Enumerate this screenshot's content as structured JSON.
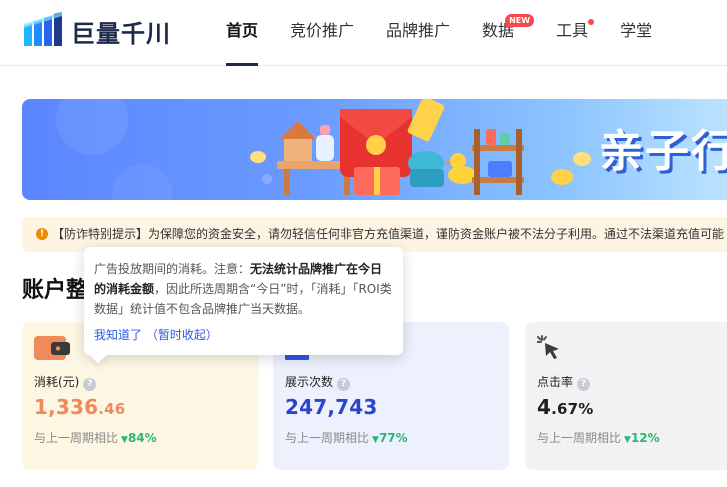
{
  "header": {
    "logo_text": "巨量千川",
    "nav": [
      {
        "label": "首页"
      },
      {
        "label": "竞价推广"
      },
      {
        "label": "品牌推广"
      },
      {
        "label": "数据",
        "badge": "NEW"
      },
      {
        "label": "工具"
      },
      {
        "label": "学堂"
      }
    ]
  },
  "banner": {
    "title": "亲子行"
  },
  "notice": {
    "text": "【防诈特别提示】为保障您的资金安全，请勿轻信任何非官方充值渠道，谨防资金账户被不法分子利用。通过不法渠道充值可能"
  },
  "section": {
    "title": "账户整"
  },
  "tooltip": {
    "line_pre": "广告投放期间的消耗。注意：",
    "line_bold": "无法统计品牌推广在今日的消耗金额",
    "line_post": "，因此所选周期含“今日”时，「消耗」「ROI类数据」统计值不包含品牌推广当天数据。",
    "ack": "我知道了",
    "collapse": "（暂时收起）"
  },
  "metrics": [
    {
      "label": "消耗(元)",
      "value_int": "1,336",
      "value_dec": ".46",
      "compare_label": "与上一周期相比",
      "change": "84%"
    },
    {
      "label": "展示次数",
      "value_int": "247,743",
      "value_dec": "",
      "compare_label": "与上一周期相比",
      "change": "77%"
    },
    {
      "label": "点击率",
      "value_int": "4",
      "value_dec": ".67%",
      "compare_label": "与上一周期相比",
      "change": "12%"
    }
  ],
  "colors": {
    "accent": "#2a45c9",
    "up": "#2bb673",
    "cost": "#f08a5d"
  }
}
